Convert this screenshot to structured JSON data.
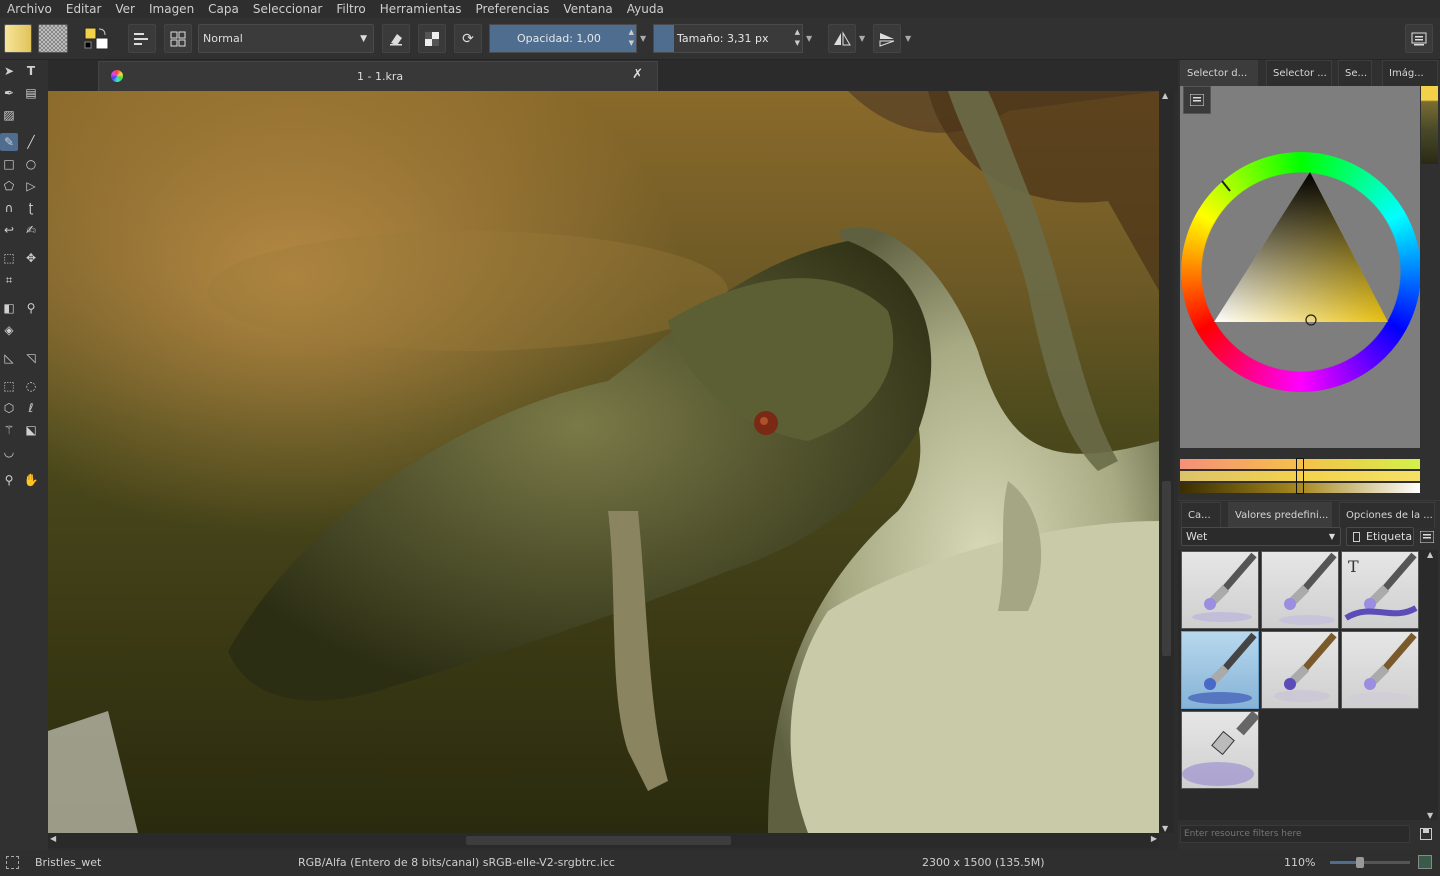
{
  "menu": [
    "Archivo",
    "Editar",
    "Ver",
    "Imagen",
    "Capa",
    "Seleccionar",
    "Filtro",
    "Herramientas",
    "Preferencias",
    "Ventana",
    "Ayuda"
  ],
  "toolbar": {
    "blend_mode": "Normal",
    "opacity": "Opacidad:  1,00",
    "opacity_fill": 1.0,
    "size": "Tamaño:  3,31 px"
  },
  "document": {
    "tab_title": "1 - 1.kra"
  },
  "dock": {
    "top_tabs": [
      "Selector d...",
      "Selector ...",
      "Se...",
      "Imág..."
    ],
    "bottom_tabs": [
      "Ca...",
      "Valores predefini...",
      "Opciones de la ..."
    ],
    "preset_filter": "Wet",
    "tag_label": "Etiqueta",
    "search_placeholder": "Enter resource filters here",
    "colors": {
      "foreground": "#f3d24a",
      "background": "#ffffff",
      "accent": "#4f6d8f"
    }
  },
  "status": {
    "preset": "Bristles_wet",
    "colorspace": "RGB/Alfa (Entero de 8 bits/canal)  sRGB-elle-V2-srgbtrc.icc",
    "dimensions": "2300 x 1500 (135.5M)",
    "zoom": "110%"
  }
}
